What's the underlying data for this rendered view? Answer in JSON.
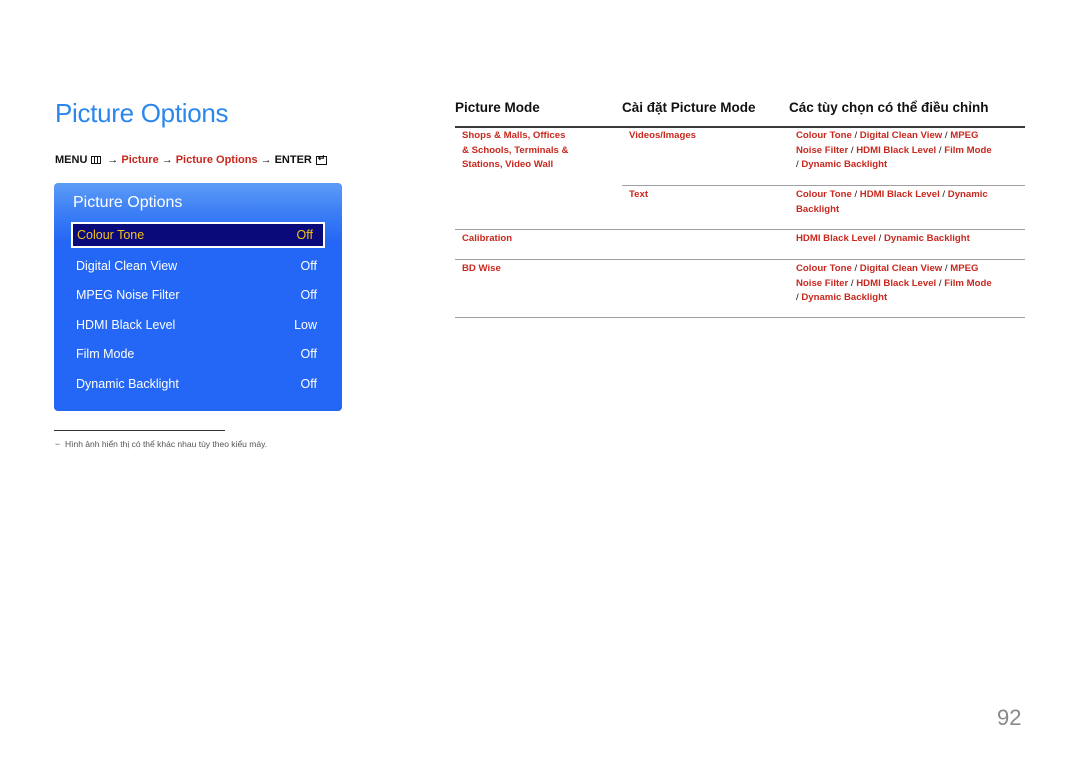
{
  "page": {
    "title": "Picture Options",
    "page_number": "92"
  },
  "breadcrumb": {
    "menu": "MENU",
    "menu_icon": "menu-icon",
    "arrow": "→",
    "items": [
      "Picture",
      "Picture Options"
    ],
    "enter": "ENTER",
    "enter_icon": "enter-icon"
  },
  "osd": {
    "title": "Picture Options",
    "items": [
      {
        "label": "Colour Tone",
        "value": "Off",
        "selected": true
      },
      {
        "label": "Digital Clean View",
        "value": "Off"
      },
      {
        "label": "MPEG Noise Filter",
        "value": "Off"
      },
      {
        "label": "HDMI Black Level",
        "value": "Low"
      },
      {
        "label": "Film Mode",
        "value": "Off"
      },
      {
        "label": "Dynamic Backlight",
        "value": "Off"
      }
    ],
    "colors": {
      "panel": "#2466f5",
      "selected_bg": "#0a0a7a",
      "selected_text": "#f5c018"
    }
  },
  "footnote": {
    "dash": "−",
    "text": "Hình ảnh hiển thị có thể khác nhau tùy theo kiểu máy."
  },
  "table": {
    "headers": [
      "Picture Mode",
      "Cài đặt Picture Mode",
      "Các tùy chọn có thể điều chỉnh"
    ],
    "rows": [
      {
        "mode_lines": [
          "Shops & Malls, Offices",
          "& Schools, Terminals &",
          "Stations, Video Wall"
        ],
        "sub": [
          {
            "setting": "Videos/Images",
            "options_lines": [
              [
                "Colour Tone",
                "Digital Clean View",
                "MPEG"
              ],
              [
                "Noise Filter",
                "HDMI Black Level",
                "Film Mode"
              ],
              [
                "",
                "Dynamic Backlight"
              ]
            ]
          },
          {
            "setting": "Text",
            "options_lines": [
              [
                "Colour Tone",
                "HDMI Black Level",
                "Dynamic"
              ],
              [
                "Backlight"
              ]
            ]
          }
        ]
      },
      {
        "mode_lines": [
          "Calibration"
        ],
        "setting": "",
        "options_lines": [
          [
            "HDMI Black Level",
            "Dynamic Backlight"
          ]
        ]
      },
      {
        "mode_lines": [
          "BD Wise"
        ],
        "setting": "",
        "options_lines": [
          [
            "Colour Tone",
            "Digital Clean View",
            "MPEG"
          ],
          [
            "Noise Filter",
            "HDMI Black Level",
            "Film Mode"
          ],
          [
            "",
            "Dynamic Backlight"
          ]
        ]
      }
    ],
    "separator": " / ",
    "colors": {
      "highlight": "#c8281e",
      "title": "#2b87ee"
    }
  }
}
